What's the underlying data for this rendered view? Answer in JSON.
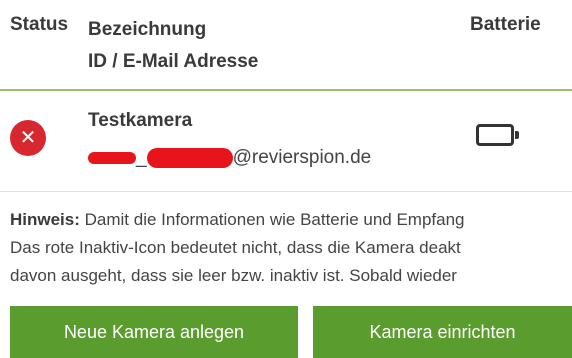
{
  "table": {
    "header": {
      "status": "Status",
      "bezeichnung": "Bezeichnung",
      "id_email": "ID / E-Mail Adresse",
      "batterie": "Batterie"
    },
    "rows": [
      {
        "status_icon": "inactive-x-icon",
        "status_color": "#d7282f",
        "name": "Testkamera",
        "email_domain": "@revierspion.de",
        "battery_icon": "battery-empty-icon"
      }
    ]
  },
  "hint": {
    "label": "Hinweis:",
    "line1": "Damit die Informationen wie Batterie und Empfang",
    "line2": "Das rote Inaktiv-Icon bedeutet nicht, dass die Kamera deakt",
    "line3": "davon ausgeht, dass sie leer bzw. inaktiv ist. Sobald wieder"
  },
  "buttons": {
    "new_camera": "Neue Kamera anlegen",
    "setup_camera": "Kamera einrichten"
  },
  "colors": {
    "accent_green": "#5b9c2e",
    "header_line": "#9dbf6a",
    "redaction": "#e8141c"
  }
}
